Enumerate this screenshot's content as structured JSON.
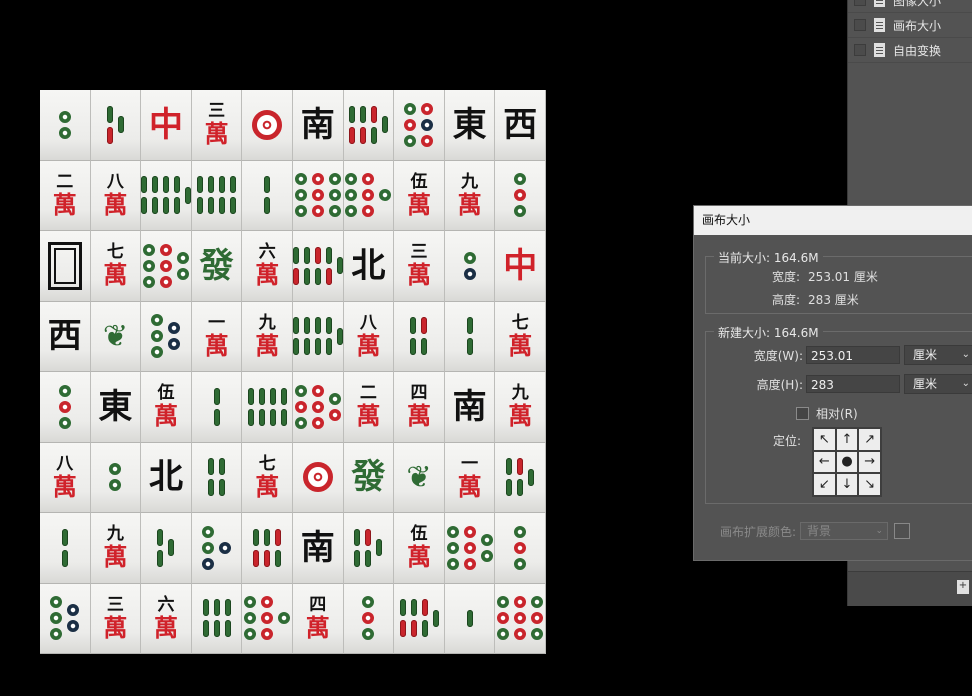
{
  "layers": {
    "items": [
      {
        "label": "图像大小"
      },
      {
        "label": "画布大小"
      },
      {
        "label": "自由变换"
      }
    ]
  },
  "dialog": {
    "title": "画布大小",
    "current": {
      "label": "当前大小: 164.6M",
      "width_label": "宽度:",
      "width_value": "253.01 厘米",
      "height_label": "高度:",
      "height_value": "283 厘米"
    },
    "new": {
      "label": "新建大小: 164.6M",
      "width_label": "宽度(W):",
      "width_value": "253.01",
      "width_unit": "厘米",
      "height_label": "高度(H):",
      "height_value": "283",
      "height_unit": "厘米",
      "relative_label": "相对(R)",
      "relative_checked": false,
      "anchor_label": "定位:",
      "anchor_arrows": [
        "↖",
        "↑",
        "↗",
        "←",
        "●",
        "→",
        "↙",
        "↓",
        "↘"
      ]
    },
    "extension": {
      "label": "画布扩展颜色:",
      "value": "背景"
    }
  },
  "tiles": [
    [
      "d2",
      "b3r",
      "C中",
      "W三",
      "d1",
      "H南",
      "b7r",
      "d6r",
      "H東",
      "H西"
    ],
    [
      "W二",
      "W八",
      "b9",
      "b8g",
      "b2",
      "d9",
      "d7",
      "W伍",
      "W九",
      "d3"
    ],
    [
      "white",
      "W七",
      "d8",
      "G發",
      "W六",
      "b9r",
      "H北",
      "W三",
      "d2b",
      "C中"
    ],
    [
      "H西",
      "bird",
      "d5",
      "W一",
      "W九",
      "b9",
      "W八",
      "b4r",
      "b2",
      "W七"
    ],
    [
      "d3",
      "H東",
      "W伍",
      "b2",
      "b8g",
      "d8r",
      "W二",
      "W四",
      "H南",
      "W九"
    ],
    [
      "W八",
      "d2",
      "H北",
      "b4",
      "W七",
      "d1",
      "G發",
      "bird",
      "W一",
      "b5r"
    ],
    [
      "b2",
      "W九",
      "b3",
      "d4",
      "b6r",
      "H南",
      "b5r",
      "W伍",
      "d8",
      "d3"
    ],
    [
      "d5",
      "W三",
      "W六",
      "b6",
      "d7",
      "W四",
      "d3",
      "b7r",
      "b1",
      "d9r"
    ]
  ]
}
